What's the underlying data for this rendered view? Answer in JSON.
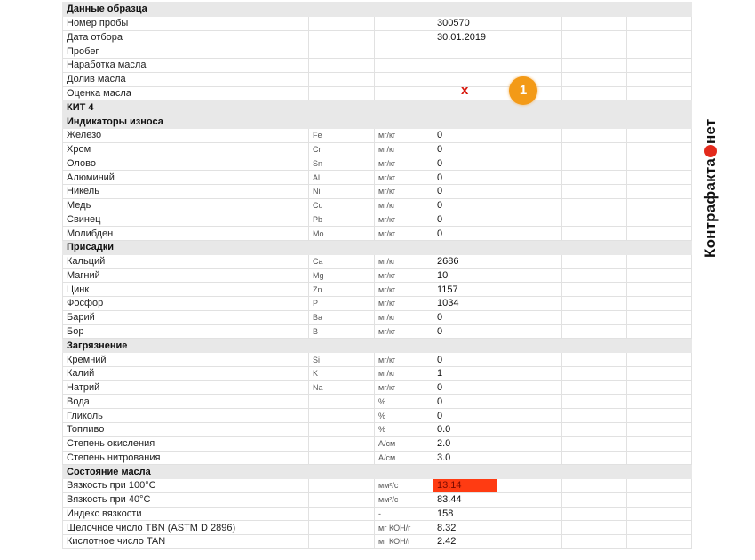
{
  "brand": {
    "name_left": "Контрафакта",
    "name_right": "нет"
  },
  "marks": {
    "cross": "x",
    "badge": "1"
  },
  "sample": {
    "title": "Данные образца",
    "rows": [
      {
        "name": "Номер пробы",
        "value": "300570"
      },
      {
        "name": "Дата отбора",
        "value": "30.01.2019"
      },
      {
        "name": "Пробег",
        "value": ""
      },
      {
        "name": "Наработка масла",
        "value": ""
      },
      {
        "name": "Долив масла",
        "value": ""
      },
      {
        "name": "Оценка масла",
        "value": ""
      }
    ]
  },
  "kit": {
    "title": "КИТ 4"
  },
  "wear": {
    "title": "Индикаторы износа",
    "rows": [
      {
        "name": "Железо",
        "symbol": "Fe",
        "unit": "мг/кг",
        "value": "0"
      },
      {
        "name": "Хром",
        "symbol": "Cr",
        "unit": "мг/кг",
        "value": "0"
      },
      {
        "name": "Олово",
        "symbol": "Sn",
        "unit": "мг/кг",
        "value": "0"
      },
      {
        "name": "Алюминий",
        "symbol": "Al",
        "unit": "мг/кг",
        "value": "0"
      },
      {
        "name": "Никель",
        "symbol": "Ni",
        "unit": "мг/кг",
        "value": "0"
      },
      {
        "name": "Медь",
        "symbol": "Cu",
        "unit": "мг/кг",
        "value": "0"
      },
      {
        "name": "Свинец",
        "symbol": "Pb",
        "unit": "мг/кг",
        "value": "0"
      },
      {
        "name": "Молибден",
        "symbol": "Mo",
        "unit": "мг/кг",
        "value": "0"
      }
    ]
  },
  "additives": {
    "title": "Присадки",
    "rows": [
      {
        "name": "Кальций",
        "symbol": "Ca",
        "unit": "мг/кг",
        "value": "2686"
      },
      {
        "name": "Магний",
        "symbol": "Mg",
        "unit": "мг/кг",
        "value": "10"
      },
      {
        "name": "Цинк",
        "symbol": "Zn",
        "unit": "мг/кг",
        "value": "1157"
      },
      {
        "name": "Фосфор",
        "symbol": "P",
        "unit": "мг/кг",
        "value": "1034"
      },
      {
        "name": "Барий",
        "symbol": "Ba",
        "unit": "мг/кг",
        "value": "0"
      },
      {
        "name": "Бор",
        "symbol": "B",
        "unit": "мг/кг",
        "value": "0"
      }
    ]
  },
  "contamination": {
    "title": "Загрязнение",
    "rows": [
      {
        "name": "Кремний",
        "symbol": "Si",
        "unit": "мг/кг",
        "value": "0"
      },
      {
        "name": "Калий",
        "symbol": "K",
        "unit": "мг/кг",
        "value": "1"
      },
      {
        "name": "Натрий",
        "symbol": "Na",
        "unit": "мг/кг",
        "value": "0"
      },
      {
        "name": "Вода",
        "symbol": "",
        "unit": "%",
        "value": "0"
      },
      {
        "name": "Гликоль",
        "symbol": "",
        "unit": "%",
        "value": "0"
      },
      {
        "name": "Топливо",
        "symbol": "",
        "unit": "%",
        "value": "0.0"
      },
      {
        "name": "Степень окисления",
        "symbol": "",
        "unit": "А/см",
        "value": "2.0"
      },
      {
        "name": "Степень нитрования",
        "symbol": "",
        "unit": "А/см",
        "value": "3.0"
      }
    ]
  },
  "condition": {
    "title": "Состояние масла",
    "rows": [
      {
        "name": "Вязкость при 100°C",
        "symbol": "",
        "unit": "мм²/с",
        "value": "13.14",
        "highlight": "#ff3b12"
      },
      {
        "name": "Вязкость при 40°C",
        "symbol": "",
        "unit": "мм²/с",
        "value": "83.44"
      },
      {
        "name": "Индекс вязкости",
        "symbol": "",
        "unit": "-",
        "value": "158"
      },
      {
        "name": "Щелочное число TBN (ASTM D 2896)",
        "symbol": "",
        "unit": "мг КОН/г",
        "value": "8.32"
      },
      {
        "name": "Кислотное число TAN",
        "symbol": "",
        "unit": "мг КОН/г",
        "value": "2.42"
      }
    ]
  }
}
